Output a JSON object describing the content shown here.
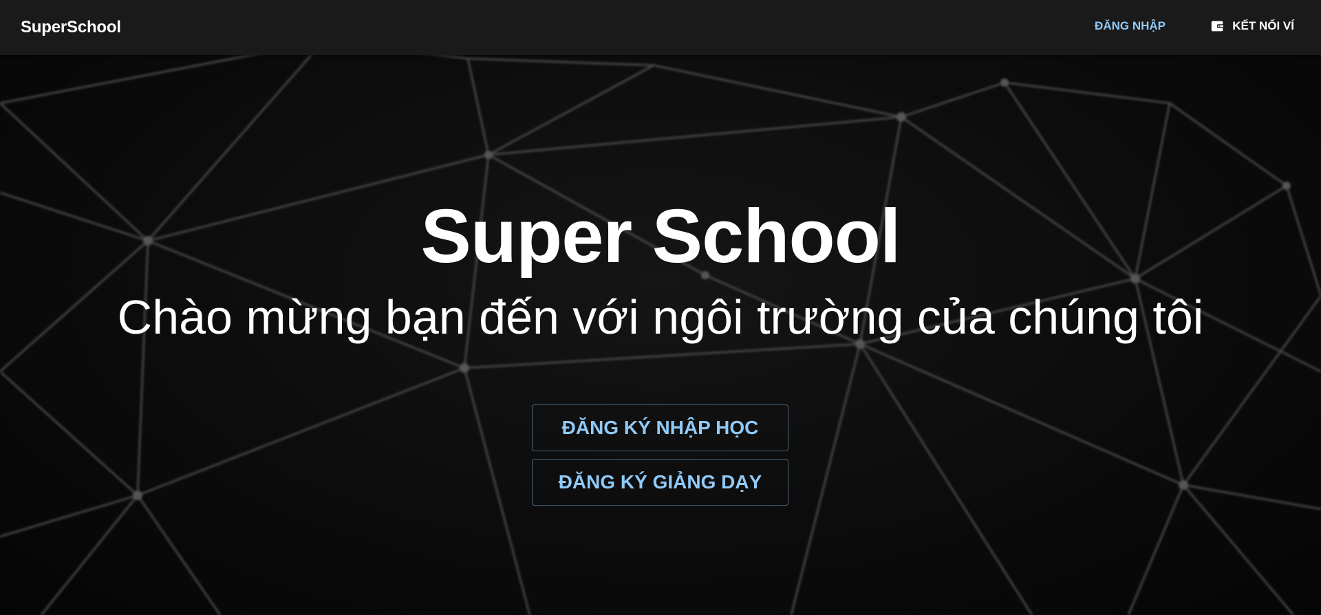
{
  "header": {
    "brand": "SuperSchool",
    "login_label": "ĐĂNG NHẬP",
    "wallet_label": "KẾT NỐI VÍ",
    "wallet_icon": "wallet-icon"
  },
  "hero": {
    "title": "Super School",
    "subtitle": "Chào mừng bạn đến với ngôi trường của chúng tôi",
    "enroll_label": "ĐĂNG KÝ NHẬP HỌC",
    "teach_label": "ĐĂNG KÝ GIẢNG DẠY"
  },
  "colors": {
    "header_bg": "#1a1a1a",
    "page_bg": "#0a0a0a",
    "accent": "#90caf9",
    "text": "#ffffff"
  }
}
